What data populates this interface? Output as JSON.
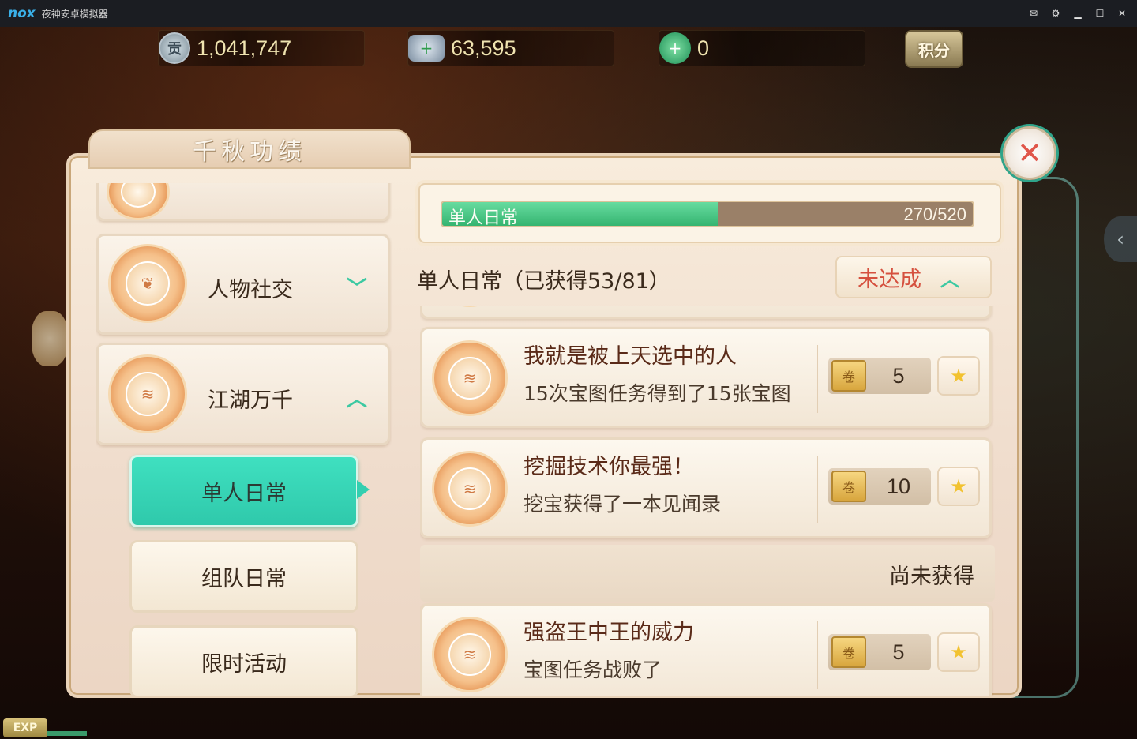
{
  "window": {
    "logo": "nox",
    "title": "夜神安卓模拟器",
    "buttons": [
      {
        "name": "mail-icon",
        "glyph": "✉"
      },
      {
        "name": "settings-icon",
        "glyph": "⚙"
      },
      {
        "name": "minimize-icon",
        "glyph": "▁"
      },
      {
        "name": "maximize-icon",
        "glyph": "☐"
      },
      {
        "name": "close-window-icon",
        "glyph": "✕"
      }
    ]
  },
  "currency": {
    "contribution": {
      "icon": "contribution-coin-icon",
      "glyph": "贡",
      "value": "1,041,747"
    },
    "silver": {
      "icon": "silver-ingot-icon",
      "glyph": "+",
      "value": "63,595"
    },
    "jade": {
      "icon": "jade-icon",
      "glyph": "+",
      "value": "0"
    },
    "points_label": "积分"
  },
  "panel": {
    "title": "千秋功绩",
    "close_glyph": "✕"
  },
  "categories": [
    {
      "label": "人物社交",
      "chevron": "﹀",
      "expanded": false
    },
    {
      "label": "江湖万千",
      "chevron": "︿",
      "expanded": true
    }
  ],
  "subcategories": [
    {
      "label": "单人日常",
      "selected": true
    },
    {
      "label": "组队日常",
      "selected": false
    },
    {
      "label": "限时活动",
      "selected": false
    }
  ],
  "progress": {
    "label": "单人日常",
    "current": 270,
    "total": 520,
    "text": "270/520"
  },
  "section": {
    "title": "单人日常（已获得53/81）",
    "status": "未达成",
    "status_chevron": "︿"
  },
  "achievements_obtained": [
    {
      "title": "我就是被上天选中的人",
      "desc": "15次宝图任务得到了15张宝图",
      "reward": "5"
    },
    {
      "title": "挖掘技术你最强！",
      "desc": "挖宝获得了一本见闻录",
      "reward": "10"
    }
  ],
  "not_obtained_label": "尚未获得",
  "achievements_pending": [
    {
      "title": "强盗王中王的威力",
      "desc": "宝图任务战败了",
      "reward": "5"
    }
  ],
  "reward_icon_glyph": "卷",
  "claim_icon_glyph": "★",
  "exp_label": "EXP",
  "colors": {
    "accent_teal": "#33cfb0",
    "progress_green": "#35b470",
    "status_red": "#d5503e",
    "close_red": "#e0564a"
  }
}
